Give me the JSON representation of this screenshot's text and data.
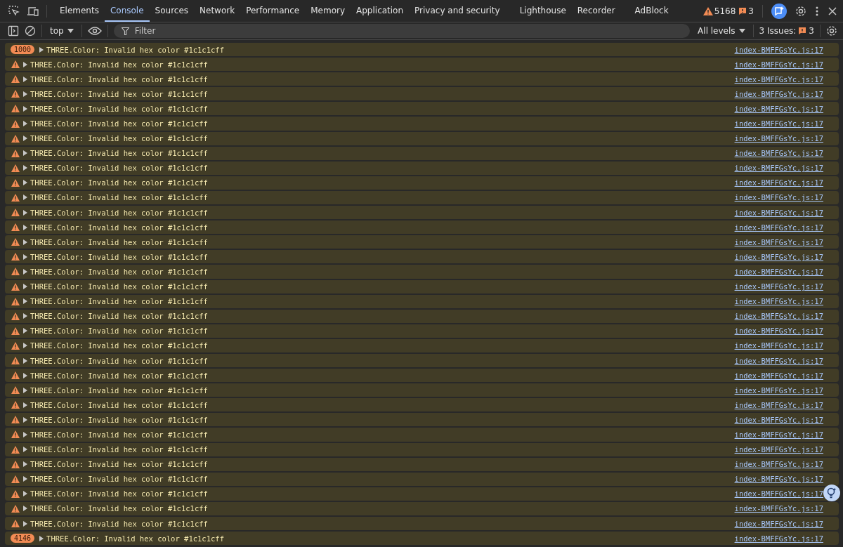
{
  "tabs": [
    {
      "label": "Elements",
      "selected": false
    },
    {
      "label": "Console",
      "selected": true
    },
    {
      "label": "Sources",
      "selected": false
    },
    {
      "label": "Network",
      "selected": false
    },
    {
      "label": "Performance",
      "selected": false
    },
    {
      "label": "Memory",
      "selected": false
    },
    {
      "label": "Application",
      "selected": false
    },
    {
      "label": "Privacy and security",
      "selected": false
    },
    {
      "label": "Lighthouse",
      "selected": false
    },
    {
      "label": "Recorder",
      "selected": false
    },
    {
      "label": "AdBlock",
      "selected": false
    }
  ],
  "counters": {
    "warnings": "5168",
    "issues": "3"
  },
  "toolbar": {
    "context": "top",
    "filter_placeholder": "Filter",
    "levels": "All levels",
    "issues_label": "3 Issues:",
    "issues_count": "3"
  },
  "messages": [
    {
      "kind": "group",
      "count": "1000",
      "text": "THREE.Color: Invalid hex color #1c1c1cff",
      "source": "index-BMFFGsYc.js:17"
    },
    {
      "kind": "warning",
      "text": "THREE.Color: Invalid hex color #1c1c1cff",
      "source": "index-BMFFGsYc.js:17"
    },
    {
      "kind": "warning",
      "text": "THREE.Color: Invalid hex color #1c1c1cff",
      "source": "index-BMFFGsYc.js:17"
    },
    {
      "kind": "warning",
      "text": "THREE.Color: Invalid hex color #1c1c1cff",
      "source": "index-BMFFGsYc.js:17"
    },
    {
      "kind": "warning",
      "text": "THREE.Color: Invalid hex color #1c1c1cff",
      "source": "index-BMFFGsYc.js:17"
    },
    {
      "kind": "warning",
      "text": "THREE.Color: Invalid hex color #1c1c1cff",
      "source": "index-BMFFGsYc.js:17"
    },
    {
      "kind": "warning",
      "text": "THREE.Color: Invalid hex color #1c1c1cff",
      "source": "index-BMFFGsYc.js:17"
    },
    {
      "kind": "warning",
      "text": "THREE.Color: Invalid hex color #1c1c1cff",
      "source": "index-BMFFGsYc.js:17"
    },
    {
      "kind": "warning",
      "text": "THREE.Color: Invalid hex color #1c1c1cff",
      "source": "index-BMFFGsYc.js:17"
    },
    {
      "kind": "warning",
      "text": "THREE.Color: Invalid hex color #1c1c1cff",
      "source": "index-BMFFGsYc.js:17"
    },
    {
      "kind": "warning",
      "text": "THREE.Color: Invalid hex color #1c1c1cff",
      "source": "index-BMFFGsYc.js:17"
    },
    {
      "kind": "warning",
      "text": "THREE.Color: Invalid hex color #1c1c1cff",
      "source": "index-BMFFGsYc.js:17"
    },
    {
      "kind": "warning",
      "text": "THREE.Color: Invalid hex color #1c1c1cff",
      "source": "index-BMFFGsYc.js:17"
    },
    {
      "kind": "warning",
      "text": "THREE.Color: Invalid hex color #1c1c1cff",
      "source": "index-BMFFGsYc.js:17"
    },
    {
      "kind": "warning",
      "text": "THREE.Color: Invalid hex color #1c1c1cff",
      "source": "index-BMFFGsYc.js:17"
    },
    {
      "kind": "warning",
      "text": "THREE.Color: Invalid hex color #1c1c1cff",
      "source": "index-BMFFGsYc.js:17"
    },
    {
      "kind": "warning",
      "text": "THREE.Color: Invalid hex color #1c1c1cff",
      "source": "index-BMFFGsYc.js:17"
    },
    {
      "kind": "warning",
      "text": "THREE.Color: Invalid hex color #1c1c1cff",
      "source": "index-BMFFGsYc.js:17"
    },
    {
      "kind": "warning",
      "text": "THREE.Color: Invalid hex color #1c1c1cff",
      "source": "index-BMFFGsYc.js:17"
    },
    {
      "kind": "warning",
      "text": "THREE.Color: Invalid hex color #1c1c1cff",
      "source": "index-BMFFGsYc.js:17"
    },
    {
      "kind": "warning",
      "text": "THREE.Color: Invalid hex color #1c1c1cff",
      "source": "index-BMFFGsYc.js:17"
    },
    {
      "kind": "warning",
      "text": "THREE.Color: Invalid hex color #1c1c1cff",
      "source": "index-BMFFGsYc.js:17"
    },
    {
      "kind": "warning",
      "text": "THREE.Color: Invalid hex color #1c1c1cff",
      "source": "index-BMFFGsYc.js:17"
    },
    {
      "kind": "warning",
      "text": "THREE.Color: Invalid hex color #1c1c1cff",
      "source": "index-BMFFGsYc.js:17"
    },
    {
      "kind": "warning",
      "text": "THREE.Color: Invalid hex color #1c1c1cff",
      "source": "index-BMFFGsYc.js:17"
    },
    {
      "kind": "warning",
      "text": "THREE.Color: Invalid hex color #1c1c1cff",
      "source": "index-BMFFGsYc.js:17"
    },
    {
      "kind": "warning",
      "text": "THREE.Color: Invalid hex color #1c1c1cff",
      "source": "index-BMFFGsYc.js:17"
    },
    {
      "kind": "warning",
      "text": "THREE.Color: Invalid hex color #1c1c1cff",
      "source": "index-BMFFGsYc.js:17"
    },
    {
      "kind": "warning",
      "text": "THREE.Color: Invalid hex color #1c1c1cff",
      "source": "index-BMFFGsYc.js:17"
    },
    {
      "kind": "warning",
      "text": "THREE.Color: Invalid hex color #1c1c1cff",
      "source": "index-BMFFGsYc.js:17"
    },
    {
      "kind": "warning",
      "text": "THREE.Color: Invalid hex color #1c1c1cff",
      "source": "index-BMFFGsYc.js:17"
    },
    {
      "kind": "warning",
      "text": "THREE.Color: Invalid hex color #1c1c1cff",
      "source": "index-BMFFGsYc.js:17"
    },
    {
      "kind": "warning",
      "text": "THREE.Color: Invalid hex color #1c1c1cff",
      "source": "index-BMFFGsYc.js:17"
    },
    {
      "kind": "group",
      "count": "4146",
      "text": "THREE.Color: Invalid hex color #1c1c1cff",
      "source": "index-BMFFGsYc.js:17"
    }
  ]
}
